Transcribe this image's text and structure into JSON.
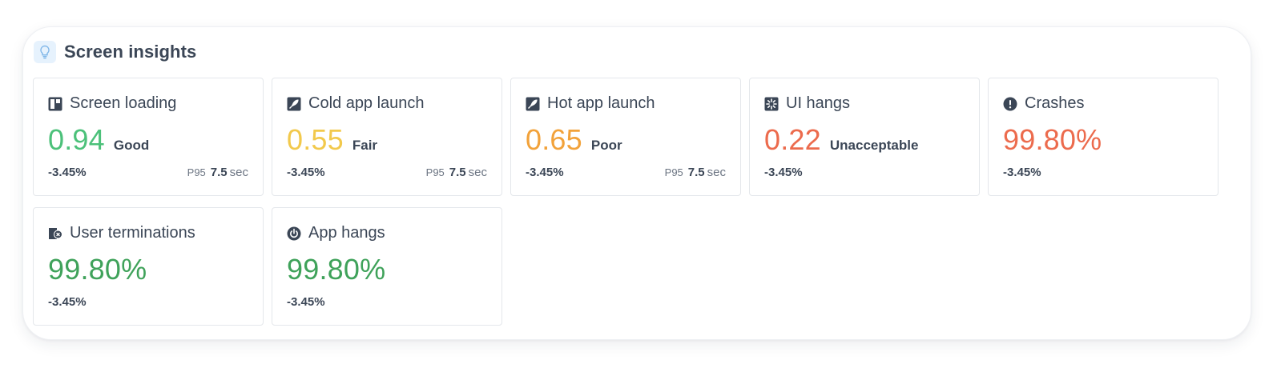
{
  "panel": {
    "title": "Screen insights",
    "icon": "lightbulb-icon"
  },
  "colors": {
    "good": "#4cc17a",
    "fair": "#f2c94c",
    "poor": "#f2a23a",
    "bad": "#ec6b4d",
    "green": "#3fa25a"
  },
  "cards": [
    {
      "title": "Screen loading",
      "icon": "screen-loading-icon",
      "value": "0.94",
      "value_color": "#4cc17a",
      "rating": "Good",
      "change": "-3.45%",
      "p95_label": "P95",
      "p95_value": "7.5",
      "p95_unit": "sec"
    },
    {
      "title": "Cold app launch",
      "icon": "rocket-icon",
      "value": "0.55",
      "value_color": "#f2c94c",
      "rating": "Fair",
      "change": "-3.45%",
      "p95_label": "P95",
      "p95_value": "7.5",
      "p95_unit": "sec"
    },
    {
      "title": "Hot app launch",
      "icon": "rocket-icon",
      "value": "0.65",
      "value_color": "#f2a23a",
      "rating": "Poor",
      "change": "-3.45%",
      "p95_label": "P95",
      "p95_value": "7.5",
      "p95_unit": "sec"
    },
    {
      "title": "UI hangs",
      "icon": "loading-spinner-icon",
      "value": "0.22",
      "value_color": "#ec6b4d",
      "rating": "Unacceptable",
      "change": "-3.45%"
    },
    {
      "title": "Crashes",
      "icon": "alert-icon",
      "value": "99.80%",
      "value_color": "#ec6b4d",
      "change": "-3.45%"
    },
    {
      "title": "User terminations",
      "icon": "terminate-icon",
      "value": "99.80%",
      "value_color": "#3fa25a",
      "change": "-3.45%"
    },
    {
      "title": "App hangs",
      "icon": "power-icon",
      "value": "99.80%",
      "value_color": "#3fa25a",
      "change": "-3.45%"
    }
  ]
}
